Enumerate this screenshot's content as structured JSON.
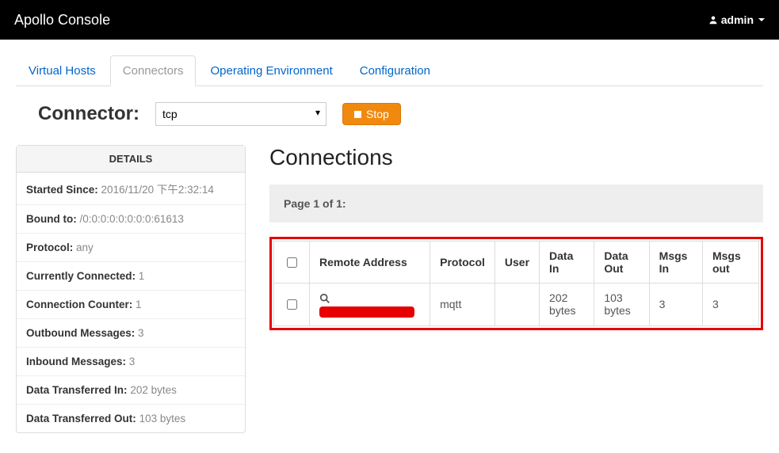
{
  "navbar": {
    "brand": "Apollo Console",
    "user": "admin"
  },
  "tabs": [
    {
      "label": "Virtual Hosts",
      "active": false
    },
    {
      "label": "Connectors",
      "active": true
    },
    {
      "label": "Operating Environment",
      "active": false
    },
    {
      "label": "Configuration",
      "active": false
    }
  ],
  "connector": {
    "label": "Connector:",
    "selected": "tcp",
    "stopLabel": "Stop"
  },
  "details": {
    "header": "DETAILS",
    "items": [
      {
        "label": "Started Since:",
        "value": "2016/11/20 下午2:32:14"
      },
      {
        "label": "Bound to:",
        "value": "/0:0:0:0:0:0:0:0:61613"
      },
      {
        "label": "Protocol:",
        "value": "any"
      },
      {
        "label": "Currently Connected:",
        "value": "1"
      },
      {
        "label": "Connection Counter:",
        "value": "1"
      },
      {
        "label": "Outbound Messages:",
        "value": "3"
      },
      {
        "label": "Inbound Messages:",
        "value": "3"
      },
      {
        "label": "Data Transferred In:",
        "value": "202 bytes"
      },
      {
        "label": "Data Transferred Out:",
        "value": "103 bytes"
      }
    ]
  },
  "connections": {
    "title": "Connections",
    "pageText": "Page 1 of 1:",
    "columns": [
      "Remote Address",
      "Protocol",
      "User",
      "Data In",
      "Data Out",
      "Msgs In",
      "Msgs out"
    ],
    "rows": [
      {
        "remoteAddress": "",
        "protocol": "mqtt",
        "user": "",
        "dataIn": "202 bytes",
        "dataOut": "103 bytes",
        "msgsIn": "3",
        "msgsOut": "3"
      }
    ]
  }
}
